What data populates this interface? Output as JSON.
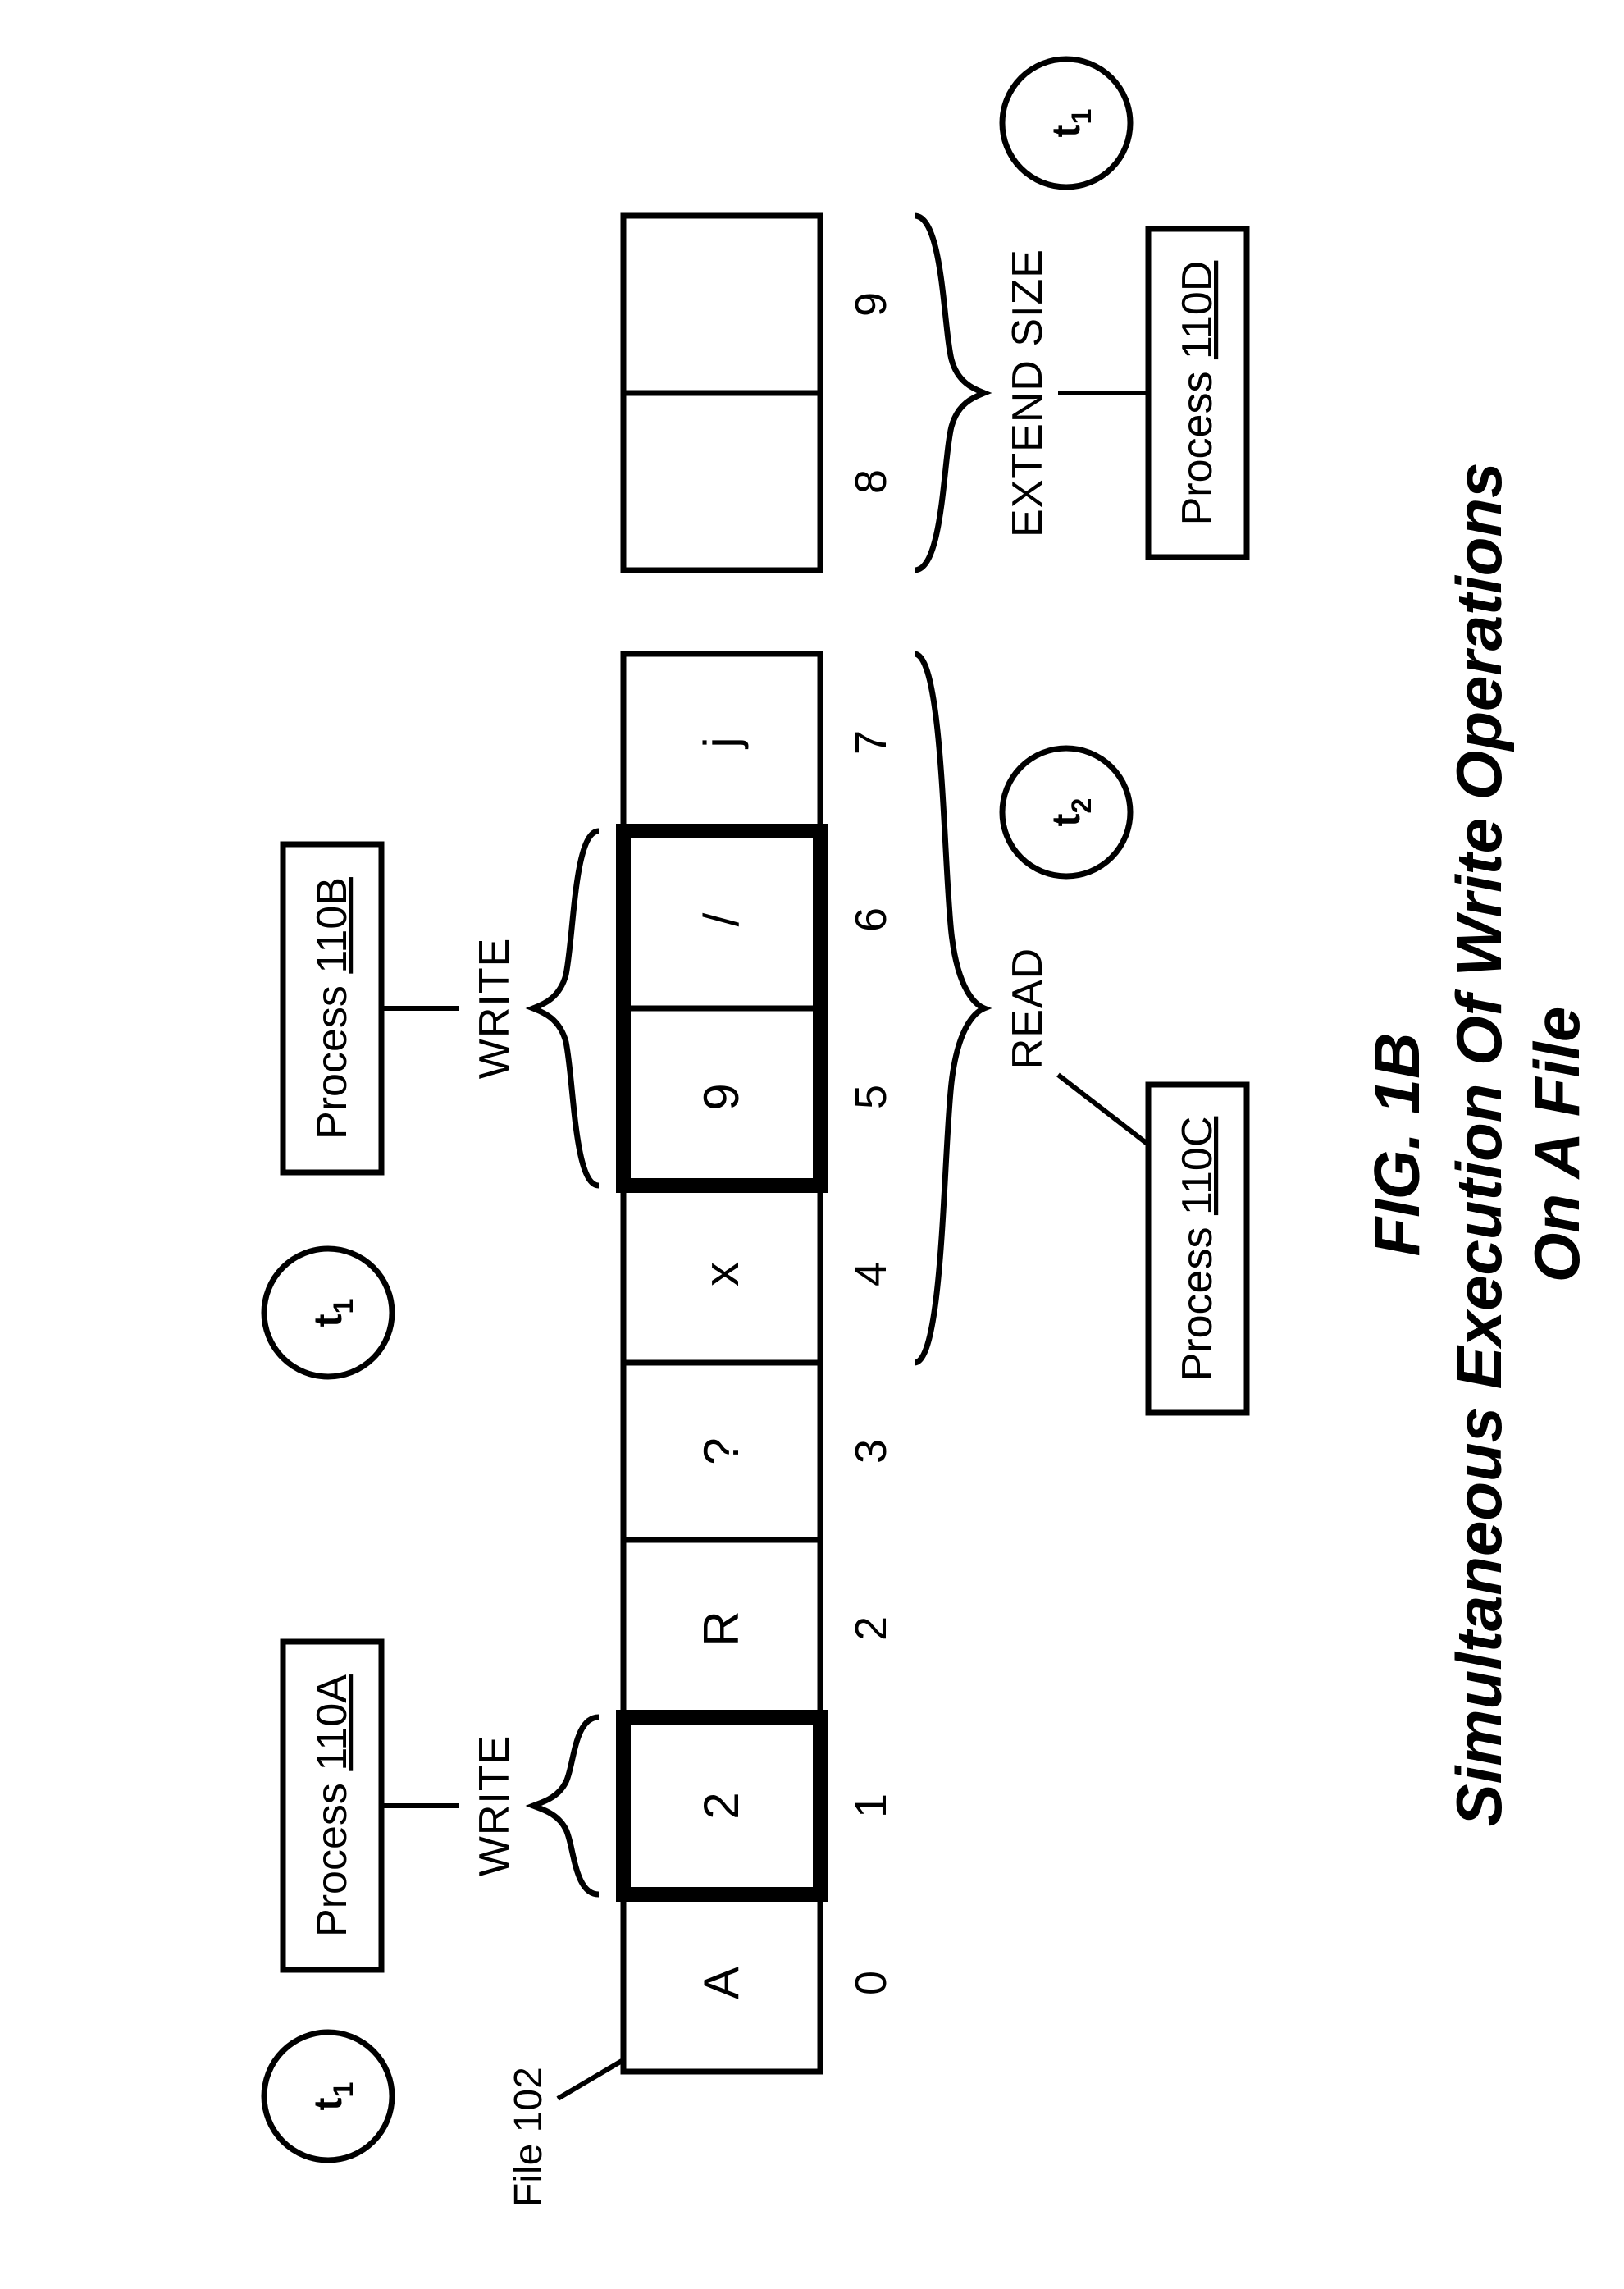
{
  "file_label": "File 102",
  "cells": [
    "A",
    "2",
    "R",
    "?",
    "x",
    "9",
    "/",
    "j",
    "",
    ""
  ],
  "indices": [
    "0",
    "1",
    "2",
    "3",
    "4",
    "5",
    "6",
    "7",
    "8",
    "9"
  ],
  "processes": {
    "a": {
      "label": "Process",
      "ref": "110A"
    },
    "b": {
      "label": "Process",
      "ref": "110B"
    },
    "c": {
      "label": "Process",
      "ref": "110C"
    },
    "d": {
      "label": "Process",
      "ref": "110D"
    }
  },
  "ops": {
    "write_a": "WRITE",
    "write_b": "WRITE",
    "read": "READ",
    "extend_size": "EXTEND SIZE"
  },
  "times": {
    "t1": "t",
    "t1_sub": "1",
    "t2": "t",
    "t2_sub": "2"
  },
  "figure": {
    "num": "FIG. 1B",
    "title_line1": "Simultaneous Execution Of Write Operations",
    "title_line2": "On A File"
  }
}
